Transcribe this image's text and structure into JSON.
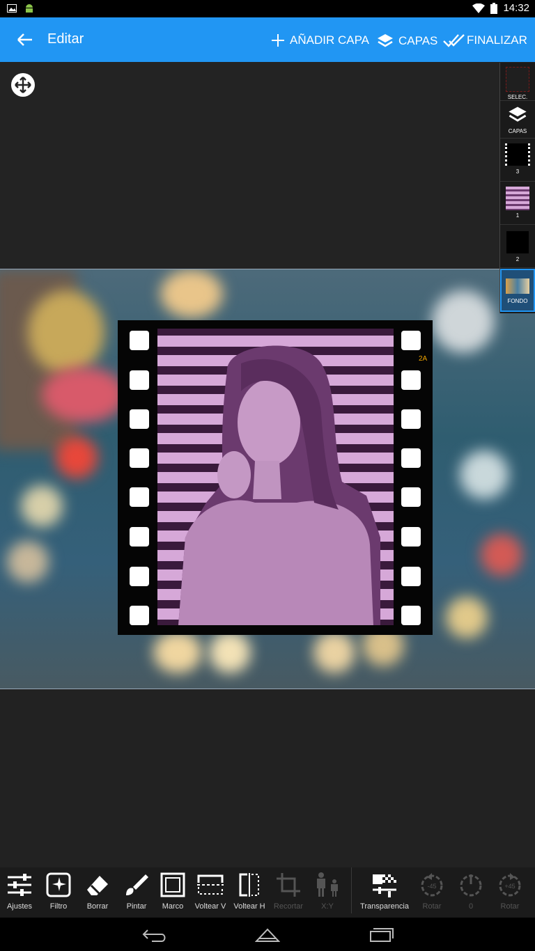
{
  "status": {
    "time": "14:32"
  },
  "appbar": {
    "title": "Editar",
    "add_layer": "AÑADIR CAPA",
    "layers": "CAPAS",
    "finish": "FINALIZAR"
  },
  "layers_panel": {
    "items": [
      {
        "label": "SELEC."
      },
      {
        "label": "CAPAS"
      },
      {
        "label": "3"
      },
      {
        "label": "1"
      },
      {
        "label": "2"
      },
      {
        "label": "FONDO"
      }
    ]
  },
  "canvas": {
    "film_label": "2A"
  },
  "toolbar": {
    "items": [
      {
        "label": "Ajustes",
        "icon": "sliders-icon"
      },
      {
        "label": "Filtro",
        "icon": "filter-icon"
      },
      {
        "label": "Borrar",
        "icon": "eraser-icon"
      },
      {
        "label": "Pintar",
        "icon": "brush-icon"
      },
      {
        "label": "Marco",
        "icon": "frame-icon"
      },
      {
        "label": "Voltear V",
        "icon": "flip-vertical-icon"
      },
      {
        "label": "Voltear H",
        "icon": "flip-horizontal-icon"
      },
      {
        "label": "Recortar",
        "icon": "crop-icon"
      },
      {
        "label": "X:Y",
        "icon": "aspect-ratio-icon"
      },
      {
        "label": "Transparencia",
        "icon": "transparency-icon"
      },
      {
        "label": "Rotar",
        "icon": "rotate-left-icon"
      },
      {
        "label": "0",
        "icon": "rotate-reset-icon"
      },
      {
        "label": "Rotar",
        "icon": "rotate-right-icon"
      }
    ],
    "rotate_left_badge": "-45",
    "rotate_right_badge": "+45"
  },
  "colors": {
    "appbar": "#2196f3",
    "background": "#222222",
    "film_label": "#f0a500"
  }
}
